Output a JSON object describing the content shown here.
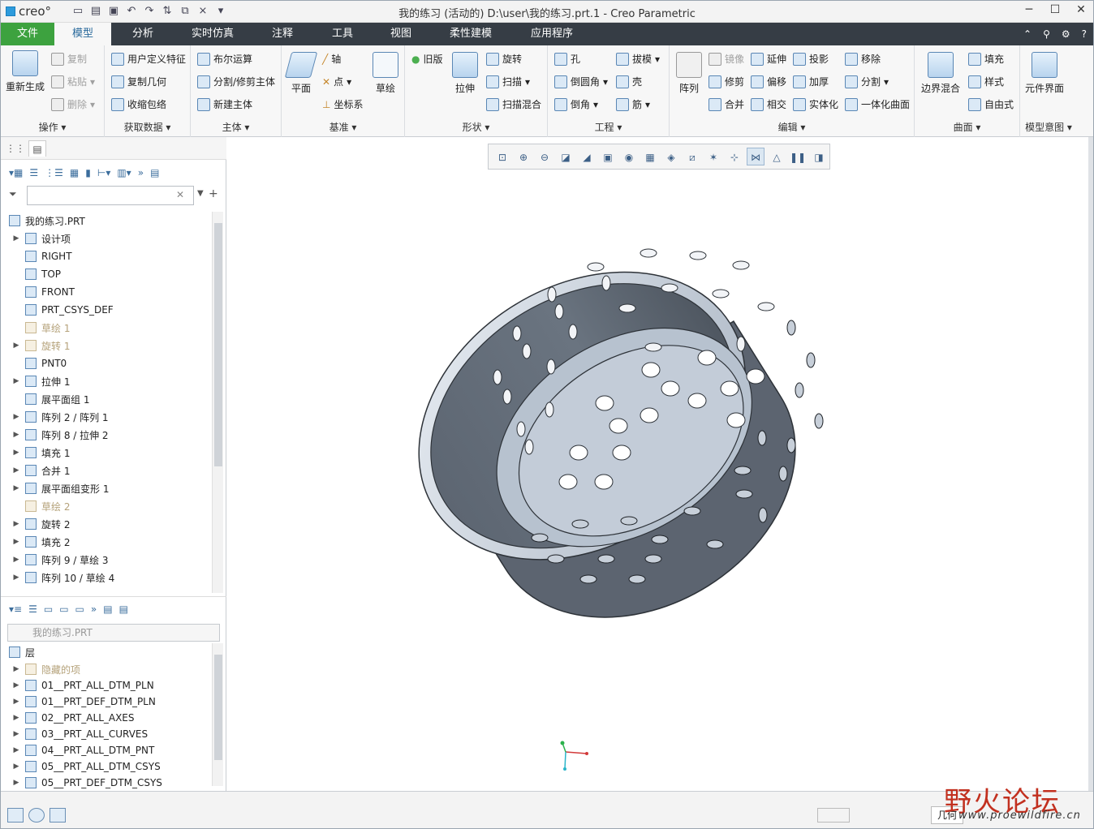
{
  "app": {
    "logo": "creo°",
    "title": "我的练习 (活动的) D:\\user\\我的练习.prt.1 - Creo Parametric"
  },
  "window_buttons": {
    "minimize": "─",
    "maximize": "☐",
    "close": "✕"
  },
  "tabs": [
    "文件",
    "模型",
    "分析",
    "实时仿真",
    "注释",
    "工具",
    "视图",
    "柔性建模",
    "应用程序"
  ],
  "ribbon": {
    "operations": {
      "regen": "重新生成",
      "copy": "复制",
      "paste": "粘贴",
      "delete": "删除",
      "label": "操作"
    },
    "get_data": {
      "udf": "用户定义特征",
      "copy_geom": "复制几何",
      "shrinkwrap": "收缩包络",
      "label": "获取数据"
    },
    "body": {
      "boolean": "布尔运算",
      "split": "分割/修剪主体",
      "new_body": "新建主体",
      "label": "主体"
    },
    "datum": {
      "plane": "平面",
      "axis": "轴",
      "point": "点",
      "csys": "坐标系",
      "sketch": "草绘",
      "label": "基准"
    },
    "shapes": {
      "legacy": "旧版",
      "extrude": "拉伸",
      "revolve": "旋转",
      "sweep": "扫描",
      "swept_blend": "扫描混合",
      "label": "形状"
    },
    "engineering": {
      "hole": "孔",
      "draft": "拔模",
      "round": "倒圆角",
      "shell": "壳",
      "chamfer": "倒角",
      "rib": "筋",
      "label": "工程"
    },
    "editing": {
      "pattern": "阵列",
      "mirror": "镜像",
      "trim": "修剪",
      "merge": "合并",
      "extend": "延伸",
      "offset": "偏移",
      "intersect": "相交",
      "project": "投影",
      "thicken": "加厚",
      "solidify": "实体化",
      "remove": "移除",
      "split": "分割",
      "unify": "一体化曲面",
      "label": "编辑"
    },
    "surfaces": {
      "boundary": "边界混合",
      "fill": "填充",
      "style": "样式",
      "freestyle": "自由式",
      "label": "曲面"
    },
    "model_intent": {
      "component_interface": "元件界面",
      "label": "模型意图"
    }
  },
  "model_tree": {
    "root": "我的练习.PRT",
    "items": [
      {
        "label": "设计项",
        "expandable": true,
        "suppressed": false
      },
      {
        "label": "RIGHT",
        "expandable": false,
        "suppressed": false
      },
      {
        "label": "TOP",
        "expandable": false,
        "suppressed": false
      },
      {
        "label": "FRONT",
        "expandable": false,
        "suppressed": false
      },
      {
        "label": "PRT_CSYS_DEF",
        "expandable": false,
        "suppressed": false
      },
      {
        "label": "草绘 1",
        "expandable": false,
        "suppressed": true
      },
      {
        "label": "旋转 1",
        "expandable": true,
        "suppressed": true
      },
      {
        "label": "PNT0",
        "expandable": false,
        "suppressed": false
      },
      {
        "label": "拉伸 1",
        "expandable": true,
        "suppressed": false
      },
      {
        "label": "展平面组 1",
        "expandable": false,
        "suppressed": false
      },
      {
        "label": "阵列 2 / 阵列 1",
        "expandable": true,
        "suppressed": false
      },
      {
        "label": "阵列 8 / 拉伸 2",
        "expandable": true,
        "suppressed": false
      },
      {
        "label": "填充 1",
        "expandable": true,
        "suppressed": false
      },
      {
        "label": "合并 1",
        "expandable": true,
        "suppressed": false
      },
      {
        "label": "展平面组变形 1",
        "expandable": true,
        "suppressed": false
      },
      {
        "label": "草绘 2",
        "expandable": false,
        "suppressed": true
      },
      {
        "label": "旋转 2",
        "expandable": true,
        "suppressed": false
      },
      {
        "label": "填充 2",
        "expandable": true,
        "suppressed": false
      },
      {
        "label": "阵列 9 / 草绘 3",
        "expandable": true,
        "suppressed": false
      },
      {
        "label": "阵列 10 / 草绘 4",
        "expandable": true,
        "suppressed": false
      }
    ]
  },
  "layer_panel": {
    "selector": "我的练习.PRT",
    "header": "层",
    "items": [
      {
        "label": "隐藏的项",
        "suppressed": true
      },
      {
        "label": "01__PRT_ALL_DTM_PLN",
        "suppressed": false
      },
      {
        "label": "01__PRT_DEF_DTM_PLN",
        "suppressed": false
      },
      {
        "label": "02__PRT_ALL_AXES",
        "suppressed": false
      },
      {
        "label": "03__PRT_ALL_CURVES",
        "suppressed": false
      },
      {
        "label": "04__PRT_ALL_DTM_PNT",
        "suppressed": false
      },
      {
        "label": "05__PRT_ALL_DTM_CSYS",
        "suppressed": false
      },
      {
        "label": "05__PRT_DEF_DTM_CSYS",
        "suppressed": false
      }
    ]
  },
  "status": {
    "filter": "几何"
  },
  "watermark": {
    "cn": "野火论坛",
    "url": "www.proewildfire.cn"
  },
  "colors": {
    "file_tab": "#3da23f",
    "tab_bar": "#363d45",
    "model_body": "#5c6470"
  }
}
